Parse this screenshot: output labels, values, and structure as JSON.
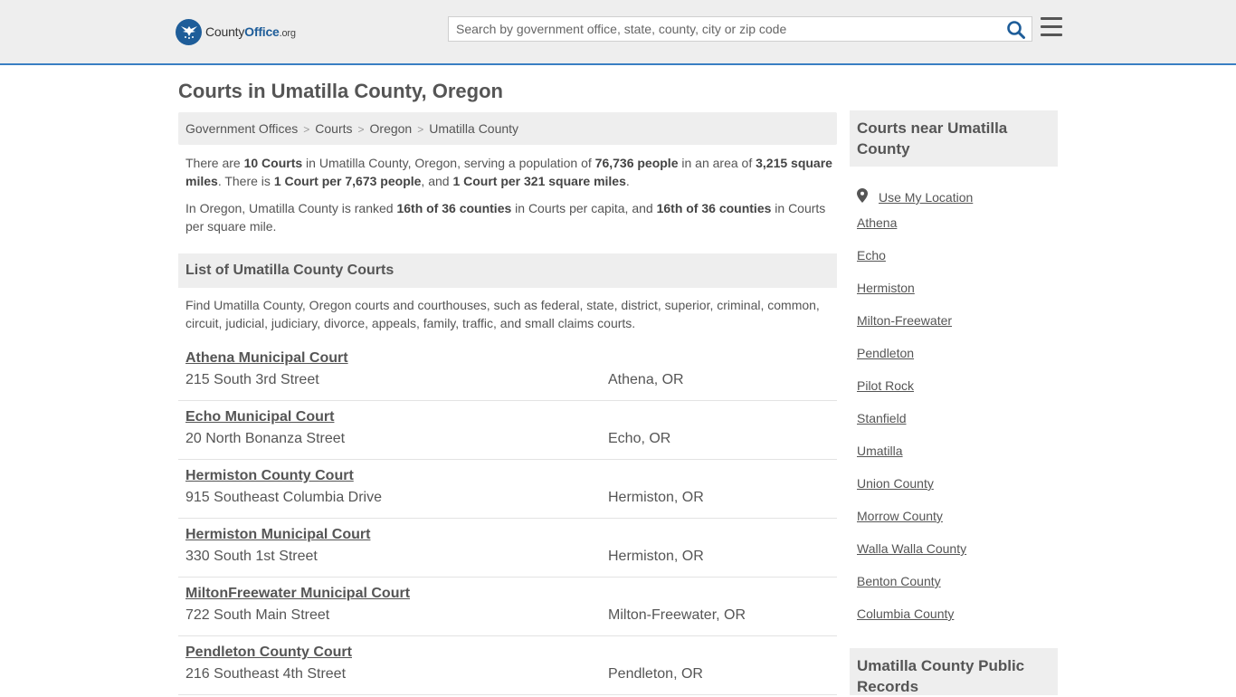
{
  "header": {
    "logo": {
      "county": "County",
      "office": "Office",
      "org": ".org"
    },
    "search_placeholder": "Search by government office, state, county, city or zip code",
    "colors": {
      "accent": "#1e5d99",
      "header_border": "#3a7fc3"
    }
  },
  "page_title": "Courts in Umatilla County, Oregon",
  "breadcrumb": [
    "Government Offices",
    "Courts",
    "Oregon",
    "Umatilla County"
  ],
  "summary": {
    "p1": {
      "t1": "There are ",
      "b1": "10 Courts",
      "t2": " in Umatilla County, Oregon, serving a population of ",
      "b2": "76,736 people",
      "t3": " in an area of ",
      "b3": "3,215 square miles",
      "t4": ". There is ",
      "b4": "1 Court per 7,673 people",
      "t5": ", and ",
      "b5": "1 Court per 321 square miles",
      "t6": "."
    },
    "p2": {
      "t1": "In Oregon, Umatilla County is ranked ",
      "b1": "16th of 36 counties",
      "t2": " in Courts per capita, and ",
      "b2": "16th of 36 counties",
      "t3": " in Courts per square mile."
    }
  },
  "list_section": {
    "title": "List of Umatilla County Courts",
    "description": "Find Umatilla County, Oregon courts and courthouses, such as federal, state, district, superior, criminal, common, circuit, judicial, judiciary, divorce, appeals, family, traffic, and small claims courts."
  },
  "courts": [
    {
      "name": "Athena Municipal Court",
      "address": "215 South 3rd Street",
      "city": "Athena, OR"
    },
    {
      "name": "Echo Municipal Court",
      "address": "20 North Bonanza Street",
      "city": "Echo, OR"
    },
    {
      "name": "Hermiston County Court",
      "address": "915 Southeast Columbia Drive",
      "city": "Hermiston, OR"
    },
    {
      "name": "Hermiston Municipal Court",
      "address": "330 South 1st Street",
      "city": "Hermiston, OR"
    },
    {
      "name": "MiltonFreewater Municipal Court",
      "address": "722 South Main Street",
      "city": "Milton-Freewater, OR"
    },
    {
      "name": "Pendleton County Court",
      "address": "216 Southeast 4th Street",
      "city": "Pendleton, OR"
    }
  ],
  "sidebar": {
    "nearby_title": "Courts near Umatilla County",
    "use_location": "Use My Location",
    "links": [
      "Athena",
      "Echo",
      "Hermiston",
      "Milton-Freewater",
      "Pendleton",
      "Pilot Rock",
      "Stanfield",
      "Umatilla",
      "Union County",
      "Morrow County",
      "Walla Walla County",
      "Benton County",
      "Columbia County"
    ],
    "records_title": "Umatilla County Public Records"
  }
}
